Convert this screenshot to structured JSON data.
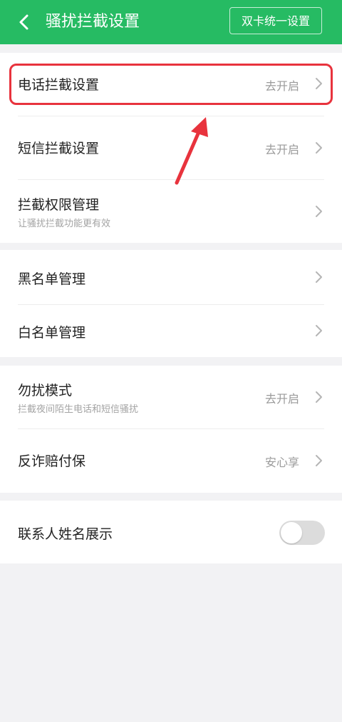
{
  "header": {
    "title": "骚扰拦截设置",
    "dual_sim_button": "双卡统一设置",
    "back_icon": "chevron-left-icon"
  },
  "rows": {
    "call_block": {
      "title": "电话拦截设置",
      "value": "去开启"
    },
    "sms_block": {
      "title": "短信拦截设置",
      "value": "去开启"
    },
    "block_permissions": {
      "title": "拦截权限管理",
      "subtitle": "让骚扰拦截功能更有效"
    },
    "blacklist": {
      "title": "黑名单管理"
    },
    "whitelist": {
      "title": "白名单管理"
    },
    "dnd_mode": {
      "title": "勿扰模式",
      "subtitle": "拦截夜间陌生电话和短信骚扰",
      "value": "去开启"
    },
    "anti_fraud": {
      "title": "反诈赔付保",
      "value": "安心享"
    },
    "contact_name_display": {
      "title": "联系人姓名展示",
      "toggle_on": false
    }
  },
  "colors": {
    "header_bg": "#26bb63",
    "highlight": "#e8333d",
    "page_bg": "#f2f2f4"
  }
}
